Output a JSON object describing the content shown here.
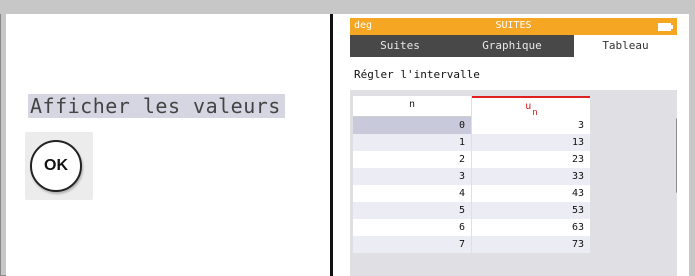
{
  "instruction": "Afficher les valeurs",
  "ok_button": "OK",
  "calculator": {
    "status_left": "deg",
    "status_title": "SUITES",
    "tabs": [
      {
        "label": "Suites",
        "active": false
      },
      {
        "label": "Graphique",
        "active": false
      },
      {
        "label": "Tableau",
        "active": true
      }
    ],
    "interval_label": "Régler l'intervalle",
    "columns": {
      "n": "n",
      "u": "u",
      "u_sub": "n"
    },
    "rows": [
      {
        "n": "0",
        "u": "3"
      },
      {
        "n": "1",
        "u": "13"
      },
      {
        "n": "2",
        "u": "23"
      },
      {
        "n": "3",
        "u": "33"
      },
      {
        "n": "4",
        "u": "43"
      },
      {
        "n": "5",
        "u": "53"
      },
      {
        "n": "6",
        "u": "63"
      },
      {
        "n": "7",
        "u": "73"
      }
    ],
    "colors": {
      "status_bar": "#f5a623",
      "tabs_bg": "#484848",
      "accent_red": "#d01818"
    }
  }
}
